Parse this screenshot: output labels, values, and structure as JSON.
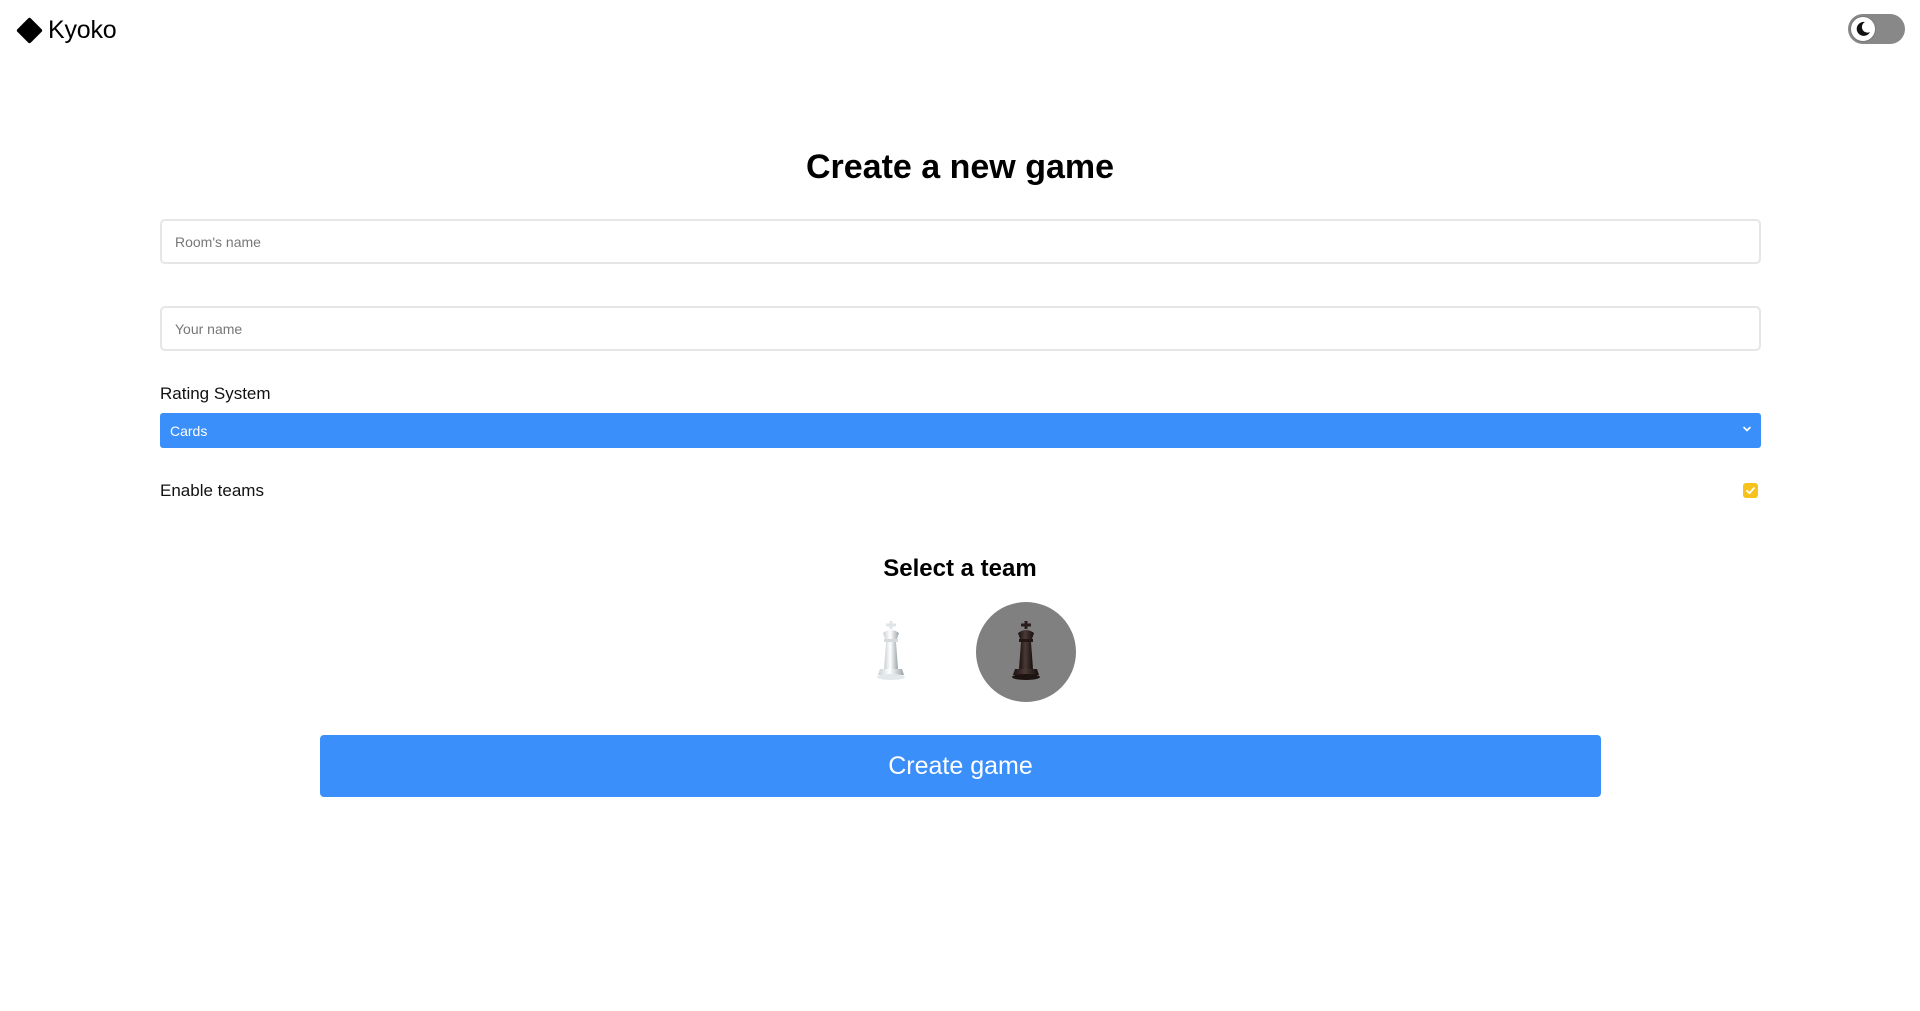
{
  "app": {
    "name": "Kyoko"
  },
  "header": {
    "theme_toggle_icon": "moon-icon"
  },
  "form": {
    "title": "Create a new game",
    "room_name": {
      "value": "",
      "placeholder": "Room's name"
    },
    "player_name": {
      "value": "",
      "placeholder": "Your name"
    },
    "rating_system": {
      "label": "Rating System",
      "selected": "Cards"
    },
    "enable_teams": {
      "label": "Enable teams",
      "checked": true
    },
    "team_select": {
      "title": "Select a team",
      "options": [
        {
          "icon": "white-king-chess-icon",
          "selected": false
        },
        {
          "icon": "black-king-chess-icon",
          "selected": true
        }
      ]
    },
    "submit_label": "Create game"
  },
  "colors": {
    "accent": "#3a8ffa",
    "checkbox": "#f7c21c",
    "selected_team_bg": "#808080"
  }
}
